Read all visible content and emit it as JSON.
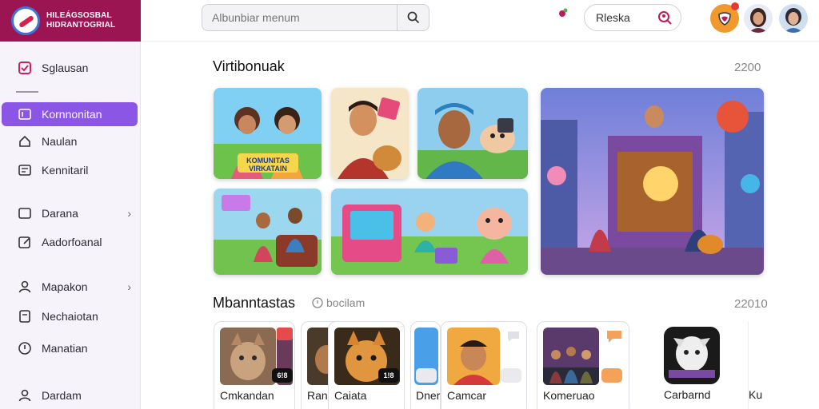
{
  "app": {
    "logo_line1": "HILEÁGSOSBAL",
    "logo_line2": "HIDRANTOGRIAL"
  },
  "sidebar": {
    "items": [
      {
        "label": "Sglausan"
      },
      {
        "label": "Kornnonitan"
      },
      {
        "label": "Naulan"
      },
      {
        "label": "Kennitaril"
      },
      {
        "label": "Darana"
      },
      {
        "label": "Aadorfoanal"
      },
      {
        "label": "Mapakon"
      },
      {
        "label": "Nechaiotan"
      },
      {
        "label": "Manatian"
      },
      {
        "label": "Dardam"
      }
    ]
  },
  "topbar": {
    "search_placeholder": "Albunbiar menum",
    "chip_label": "Rleska"
  },
  "featured": {
    "title": "Virtibonuak",
    "count": "2200",
    "tile_caption": "KOMUNITAS VIRKATAIN"
  },
  "apps_section": {
    "title": "Mbanntastas",
    "subtitle": "bocilam",
    "count": "22010",
    "cards": [
      {
        "name": "Cmkandan",
        "badge": "6!8"
      },
      {
        "name": "Ran",
        "badge": ""
      },
      {
        "name": "Caiata",
        "badge": "1!8"
      },
      {
        "name": "Dner",
        "badge": ""
      },
      {
        "name": "Camcar",
        "badge": ""
      },
      {
        "name": "Komeruao",
        "badge": ""
      },
      {
        "name": "Carbarnd",
        "badge": ""
      },
      {
        "name": "Ku",
        "badge": ""
      }
    ]
  },
  "colors": {
    "brand": "#9b1552",
    "accent": "#8b55e6",
    "shield": "#f09a2e"
  },
  "icons": [
    "logo-icon",
    "search-icon",
    "notification-icon",
    "user-search-icon",
    "shield-icon"
  ]
}
